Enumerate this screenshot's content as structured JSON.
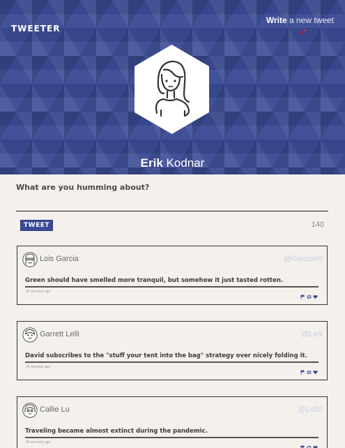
{
  "header": {
    "brand": "TWEETER",
    "write_bold": "Write",
    "write_rest": " a new tweet",
    "pen_icon": "pen-icon",
    "accent": "#c0203a"
  },
  "profile": {
    "first_name": "Erik",
    "last_name": " Kodnar"
  },
  "compose": {
    "label": "What are you humming about?",
    "placeholder": "",
    "button_label": "TWEET",
    "char_count": "140"
  },
  "colors": {
    "banner": "#3b4a94",
    "background": "#f4f1ec",
    "action_icons": "#3b4a94"
  },
  "tweets": [
    {
      "name": "Lois Garcia",
      "handle": "@Garcia80",
      "text": "Green should have smelled more tranquil, but somehow it just tasted rotten.",
      "time": "34 seconds ago"
    },
    {
      "name": "Garrett Lelli",
      "handle": "@Lelli",
      "text": "David subscribes to the \"stuff your tent into the bag\" strategy over nicely folding it.",
      "time": "34 seconds ago"
    },
    {
      "name": "Callie Lu",
      "handle": "@Lu50",
      "text": "Traveling became almost extinct during the pandemic.",
      "time": "34 seconds ago"
    }
  ]
}
